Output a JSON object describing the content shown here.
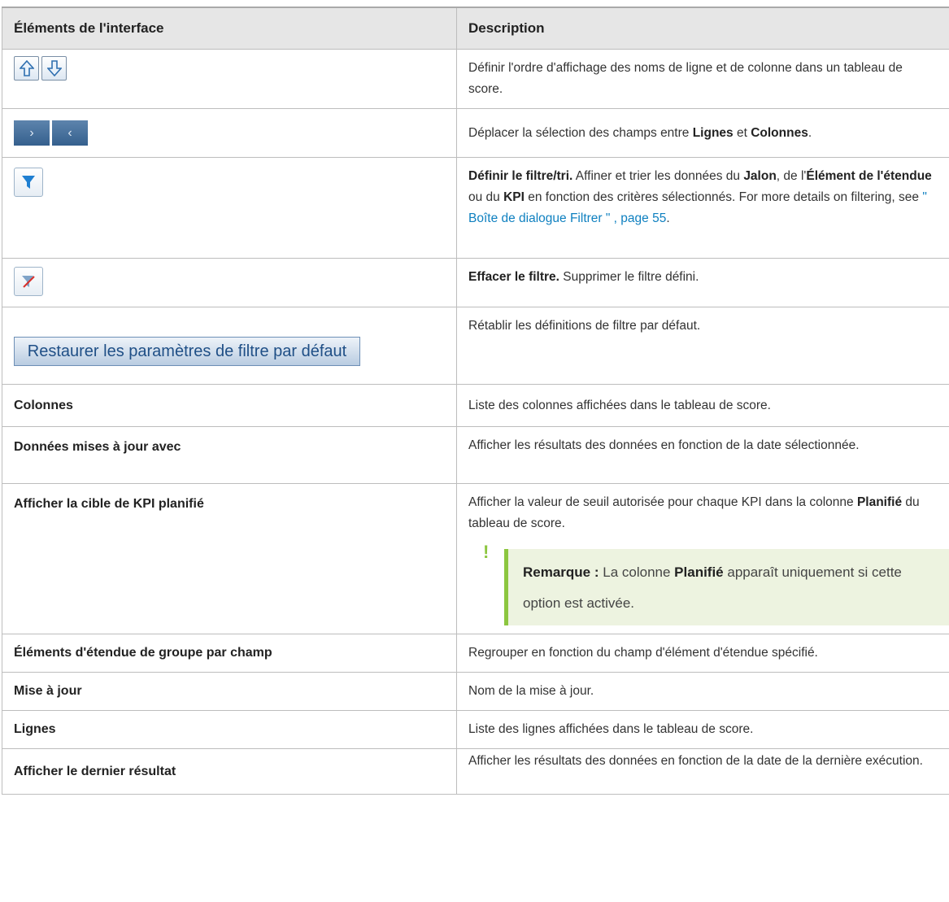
{
  "header": {
    "col1": "Éléments de l'interface",
    "col2": "Description"
  },
  "rows": {
    "sort": {
      "desc": "Définir l'ordre d'affichage des noms de ligne et de colonne dans un tableau de score."
    },
    "move": {
      "pre": "Déplacer la sélection des champs entre ",
      "lignes": "Lignes",
      "mid": " et ",
      "colonnes": "Colonnes",
      "post": "."
    },
    "filter": {
      "title": "Définir le filtre/tri.",
      "t1": " Affiner et trier les données du ",
      "jalon": "Jalon",
      "t2": ", de l'",
      "element": "Élément de l'étendue",
      "t3": " ou du ",
      "kpi": "KPI",
      "t4": " en fonction des critères sélectionnés. For more details on filtering, see ",
      "link": "\" Boîte de dialogue Filtrer \" , page 55",
      "t5": "."
    },
    "clear": {
      "title": "Effacer le filtre.",
      "desc": " Supprimer le filtre défini."
    },
    "restore": {
      "button": "Restaurer les paramètres de filtre par défaut",
      "desc": "Rétablir les définitions de filtre par défaut."
    },
    "colonnes": {
      "label": "Colonnes",
      "desc": "Liste des colonnes affichées dans le tableau de score."
    },
    "donnees": {
      "label": "Données mises à jour avec",
      "desc": "Afficher les résultats des données en fonction de la date sélectionnée."
    },
    "cible": {
      "label": "Afficher la cible de KPI planifié",
      "d1": "Afficher la valeur de seuil autorisée pour chaque KPI dans la colonne ",
      "planifie": "Planifié",
      "d2": " du tableau de score.",
      "note_label": "Remarque :",
      "note1": " La colonne ",
      "note_planifie": "Planifié",
      "note2": " apparaît uniquement si cette option est activée."
    },
    "groupe": {
      "label": "Éléments d'étendue de groupe par champ",
      "desc": "Regrouper en fonction du champ d'élément d'étendue spécifié."
    },
    "maj": {
      "label": "Mise à jour",
      "desc": "Nom de la mise à jour."
    },
    "lignes": {
      "label": "Lignes",
      "desc": "Liste des lignes affichées dans le tableau de score."
    },
    "dernier": {
      "label": "Afficher le dernier résultat",
      "desc": "Afficher les résultats des données en fonction de la date de la dernière exécution."
    }
  },
  "icons": [
    "up-arrow-icon",
    "down-arrow-icon",
    "move-right-icon",
    "move-left-icon",
    "filter-icon",
    "clear-filter-icon",
    "note-exclamation-icon"
  ],
  "colors": {
    "header_bg": "#e6e6e6",
    "link": "#0f80c0",
    "note_accent": "#8cc63f",
    "note_bg": "#edf3e0"
  }
}
